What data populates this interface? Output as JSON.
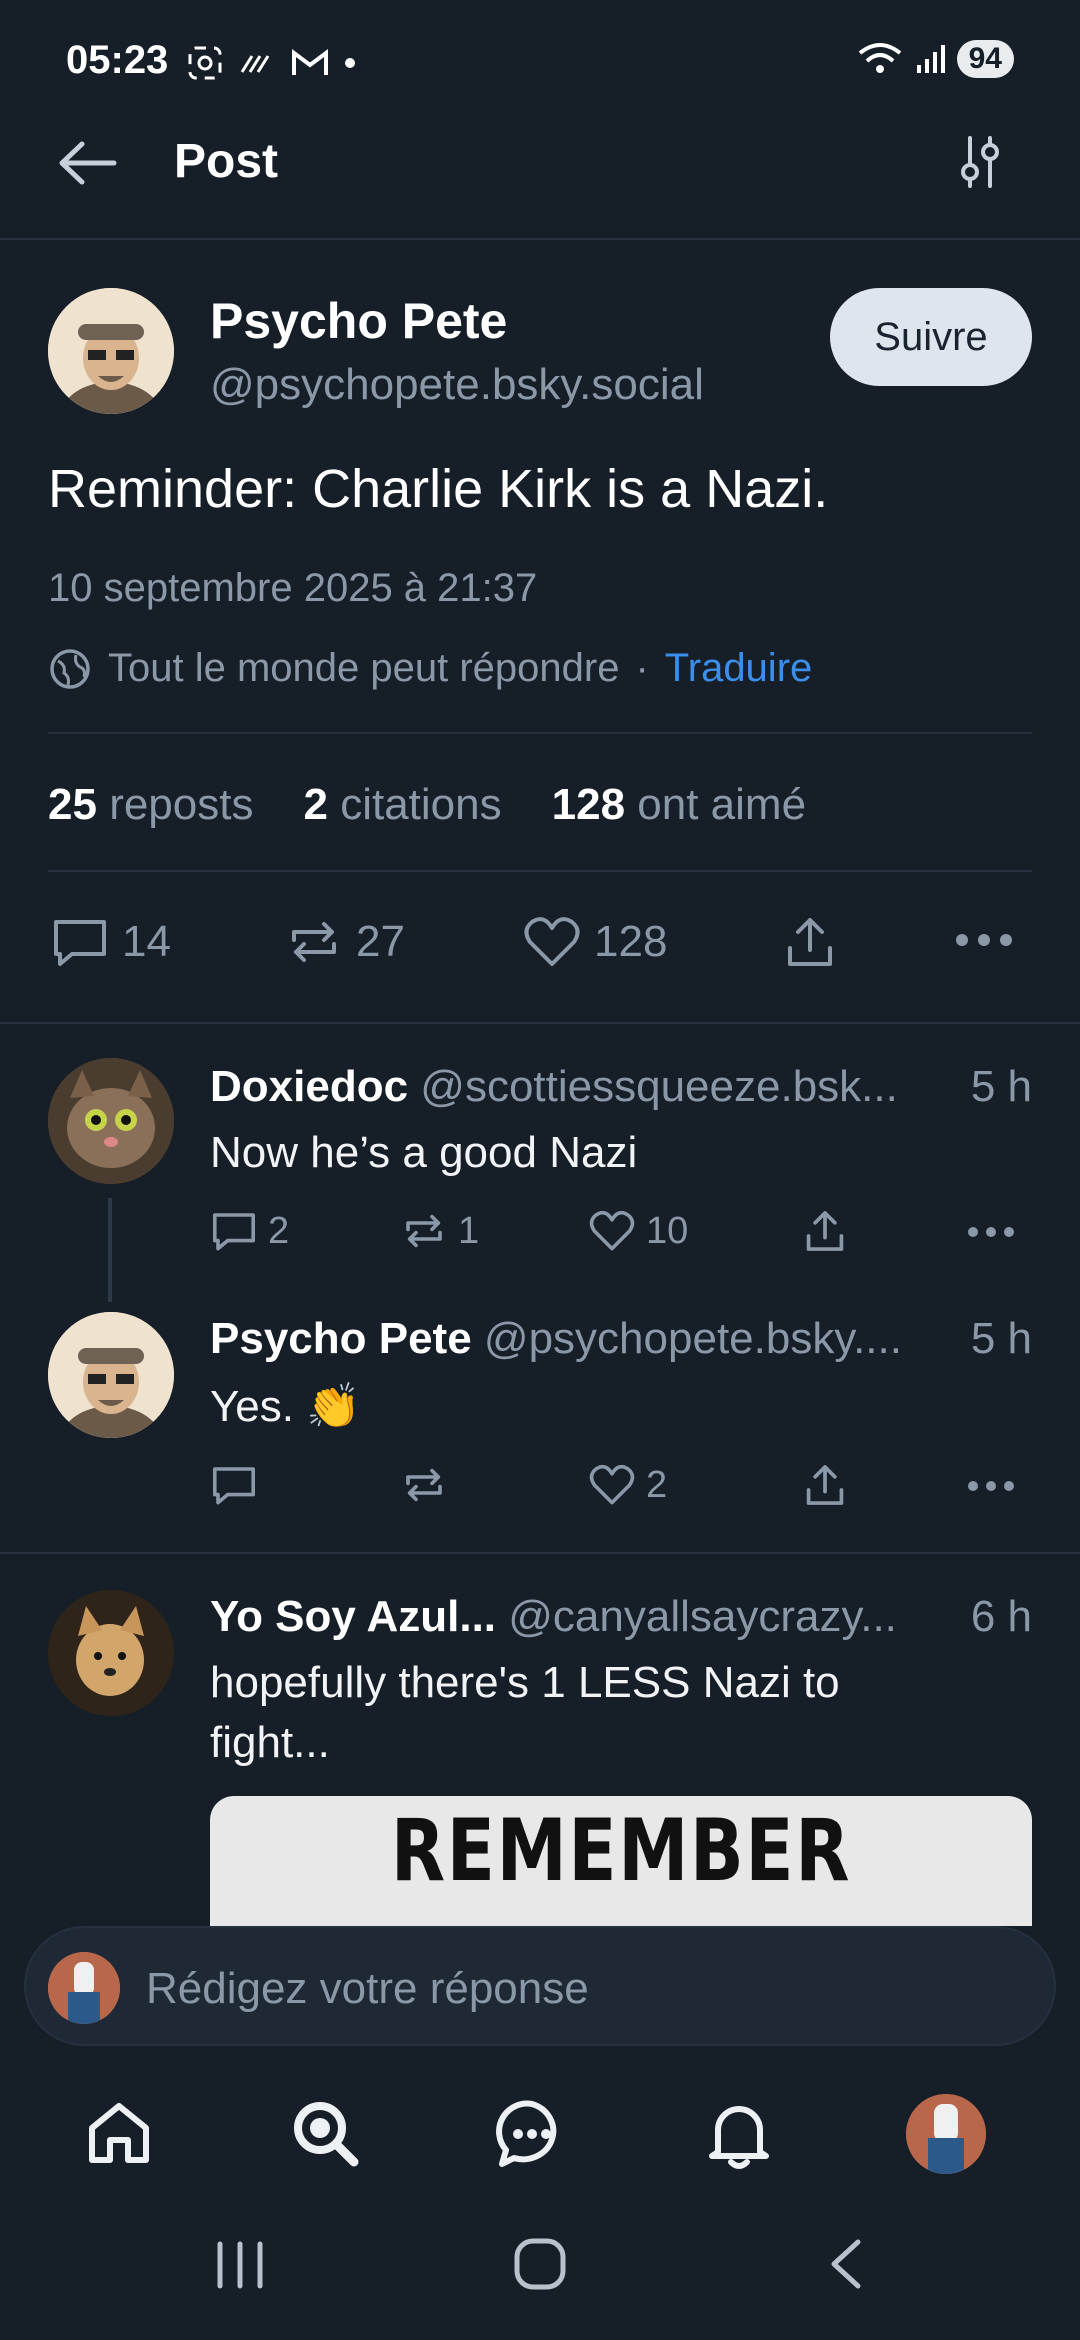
{
  "status": {
    "time": "05:23",
    "battery": "94"
  },
  "header": {
    "title": "Post"
  },
  "post": {
    "author_name": "Psycho Pete",
    "author_handle": "@psychopete.bsky.social",
    "follow_label": "Suivre",
    "text": "Reminder: Charlie Kirk is a Nazi.",
    "timestamp": "10 septembre 2025 à 21:37",
    "reply_setting": "Tout le monde peut répondre",
    "separator": "·",
    "translate_label": "Traduire",
    "stats": {
      "reposts_count": "25",
      "reposts_label": "reposts",
      "quotes_count": "2",
      "quotes_label": "citations",
      "likes_count": "128",
      "likes_label": "ont aimé"
    },
    "actions": {
      "replies": "14",
      "reposts": "27",
      "likes": "128"
    }
  },
  "replies": [
    {
      "name": "Doxiedoc",
      "handle": "@scottiessqueeze.bsk...",
      "time": "5 h",
      "text": "Now he’s a good Nazi",
      "replies": "2",
      "reposts": "1",
      "likes": "10"
    },
    {
      "name": "Psycho Pete",
      "handle": "@psychopete.bsky....",
      "time": "5 h",
      "text": "Yes. 👏",
      "replies": "",
      "reposts": "",
      "likes": "2"
    },
    {
      "name": "Yo Soy Azul...",
      "handle": "@canyallsaycrazy...",
      "time": "6 h",
      "text_line1": "hopefully there's 1 LESS Nazi to",
      "text_line2": "fight...",
      "image_text": "REMEMBER WHEN"
    }
  ],
  "compose": {
    "placeholder": "Rédigez votre réponse"
  },
  "colors": {
    "background": "#161e27",
    "accent": "#3b8fea",
    "muted": "#8b98a8"
  }
}
